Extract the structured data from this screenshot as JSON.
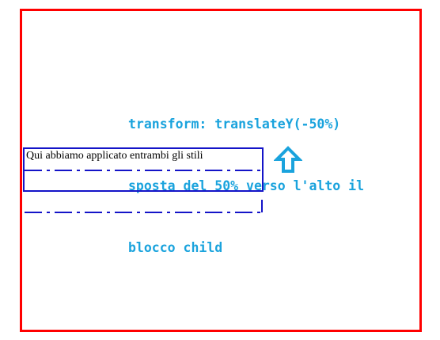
{
  "caption": {
    "line1": "transform: translateY(-50%)",
    "line2": "sposta del 50% verso l'alto il",
    "line3": "blocco child"
  },
  "child": {
    "text": "Qui abbiamo applicato entrambi gli stili"
  },
  "colors": {
    "parent_border": "#ff0000",
    "child_border": "#1414c8",
    "caption_text": "#1aa3dd",
    "arrow": "#1aa3dd"
  },
  "icons": {
    "arrow": "arrow-up-icon"
  }
}
